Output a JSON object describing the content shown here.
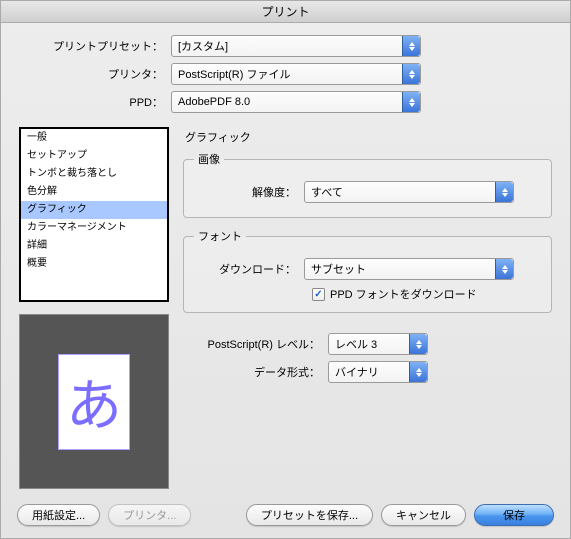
{
  "window": {
    "title": "プリント"
  },
  "top": {
    "preset_label": "プリントプリセット：",
    "preset_value": "[カスタム]",
    "printer_label": "プリンタ：",
    "printer_value": "PostScript(R) ファイル",
    "ppd_label": "PPD：",
    "ppd_value": "AdobePDF 8.0"
  },
  "sidebar": {
    "items": [
      "一般",
      "セットアップ",
      "トンボと裁ち落とし",
      "色分解",
      "グラフィック",
      "カラーマネージメント",
      "詳細",
      "概要"
    ],
    "selected_index": 4
  },
  "preview": {
    "char": "あ"
  },
  "panel": {
    "title": "グラフィック",
    "image_legend": "画像",
    "resolution_label": "解像度：",
    "resolution_value": "すべて",
    "font_legend": "フォント",
    "download_label": "ダウンロード：",
    "download_value": "サブセット",
    "ppd_fonts_checkbox": "PPD フォントをダウンロード",
    "ppd_fonts_checked": true,
    "ps_level_label": "PostScript(R) レベル：",
    "ps_level_value": "レベル 3",
    "data_format_label": "データ形式：",
    "data_format_value": "バイナリ"
  },
  "footer": {
    "page_setup": "用紙設定...",
    "printer": "プリンタ...",
    "save_preset": "プリセットを保存...",
    "cancel": "キャンセル",
    "save": "保存"
  }
}
